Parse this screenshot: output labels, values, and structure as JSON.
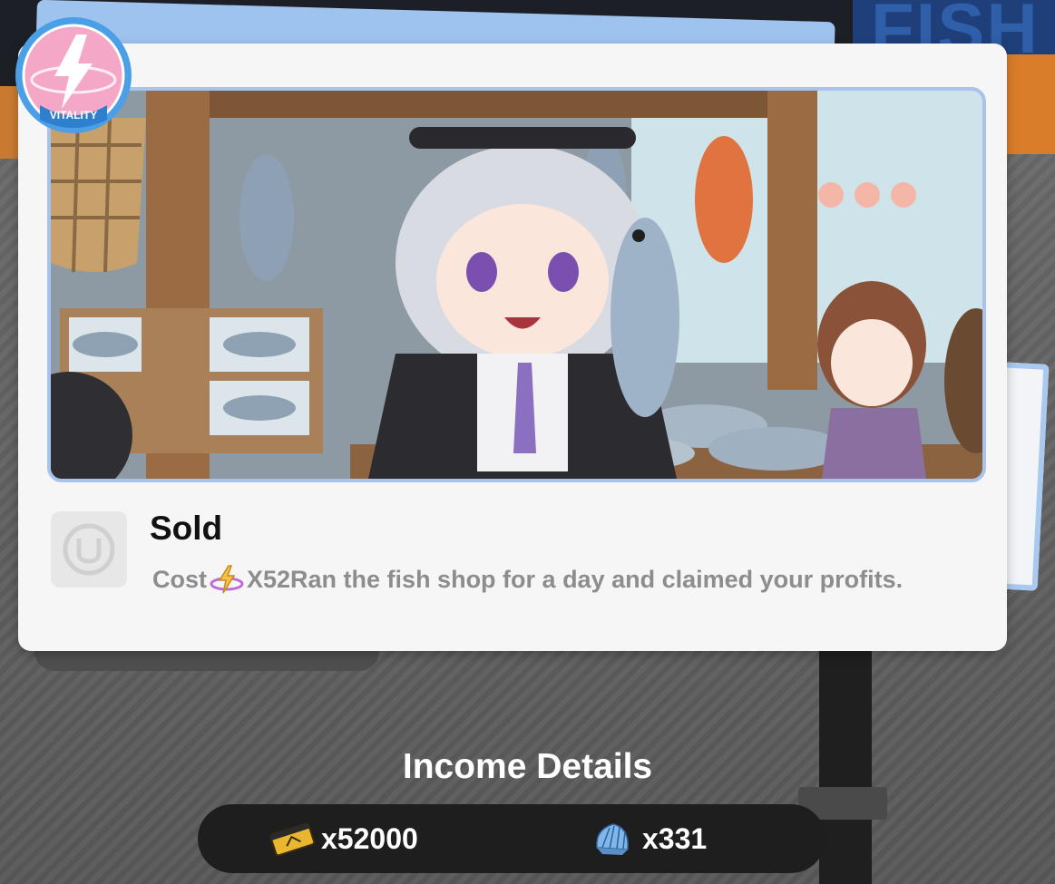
{
  "background": {
    "sign_text": "FISH"
  },
  "badge": {
    "label": "VITALITY"
  },
  "event": {
    "title": "Sold",
    "cost_label": "Cost",
    "cost_value": "X52",
    "description": "Ran the fish shop for a day and claimed your profits."
  },
  "income": {
    "title": "Income Details",
    "rewards": [
      {
        "icon": "dennies-ticket-icon",
        "amount": "x52000"
      },
      {
        "icon": "shell-icon",
        "amount": "x331"
      }
    ]
  },
  "colors": {
    "card": "#f6f6f6",
    "frame_border": "#a8c4ec",
    "badge_pink": "#f5a7c7",
    "badge_blue": "#4a9fe6",
    "income_bar": "#1e1e1e"
  }
}
